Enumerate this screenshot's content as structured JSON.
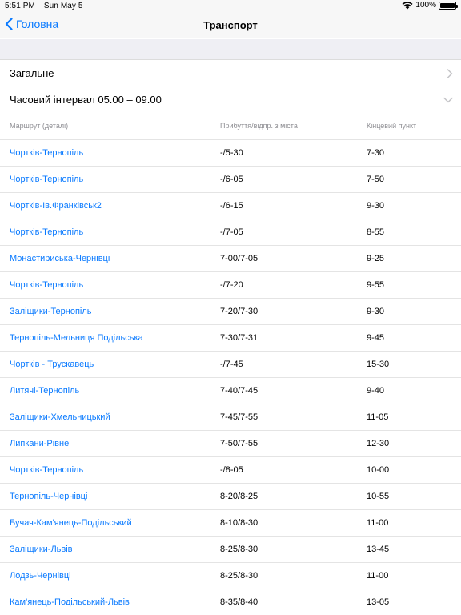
{
  "status": {
    "time": "5:51 PM",
    "date": "Sun May 5",
    "battery": "100%",
    "battery_level": 1.0
  },
  "nav": {
    "back_label": "Головна",
    "title": "Транспорт"
  },
  "sections": {
    "general_label": "Загальне",
    "interval_label": "Часовий інтервал 05.00 – 09.00"
  },
  "table": {
    "columns": [
      "Маршрут (деталі)",
      "Прибуття/відпр. з міста",
      "Кінцевий пункт"
    ],
    "rows": [
      [
        "Чортків-Тернопіль",
        "-/5-30",
        "7-30"
      ],
      [
        "Чортків-Тернопіль",
        "-/6-05",
        "7-50"
      ],
      [
        "Чортків-Ів.Франківськ2",
        "-/6-15",
        "9-30"
      ],
      [
        "Чортків-Тернопіль",
        "-/7-05",
        "8-55"
      ],
      [
        "Монастириська-Чернівці",
        "7-00/7-05",
        "9-25"
      ],
      [
        "Чортків-Тернопіль",
        "-/7-20",
        "9-55"
      ],
      [
        "Заліщики-Тернопіль",
        "7-20/7-30",
        "9-30"
      ],
      [
        "Тернопіль-Мельниця Подільська",
        "7-30/7-31",
        "9-45"
      ],
      [
        "Чортків - Трускавець",
        "-/7-45",
        "15-30"
      ],
      [
        "Литячі-Тернопіль",
        "7-40/7-45",
        "9-40"
      ],
      [
        "Заліщики-Хмельницький",
        "7-45/7-55",
        "11-05"
      ],
      [
        "Липкани-Рівне",
        "7-50/7-55",
        "12-30"
      ],
      [
        "Чортків-Тернопіль",
        "-/8-05",
        "10-00"
      ],
      [
        "Тернопіль-Чернівці",
        "8-20/8-25",
        "10-55"
      ],
      [
        "Бучач-Кам'янець-Подільський",
        "8-10/8-30",
        "11-00"
      ],
      [
        "Заліщики-Львів",
        "8-25/8-30",
        "13-45"
      ],
      [
        "Лодзь-Чернівці",
        "8-25/8-30",
        "11-00"
      ],
      [
        "Кам'янець-Подільський-Львів",
        "8-35/8-40",
        "13-05"
      ]
    ]
  },
  "colors": {
    "accent": "#0a7aff",
    "bar_bg": "#f7f7f7",
    "group_bg": "#efeff4"
  },
  "icons": {
    "back": "chevron-left-icon",
    "disclosure": "chevron-right-icon",
    "expand": "chevron-down-icon",
    "wifi": "wifi-icon",
    "battery": "battery-icon"
  }
}
